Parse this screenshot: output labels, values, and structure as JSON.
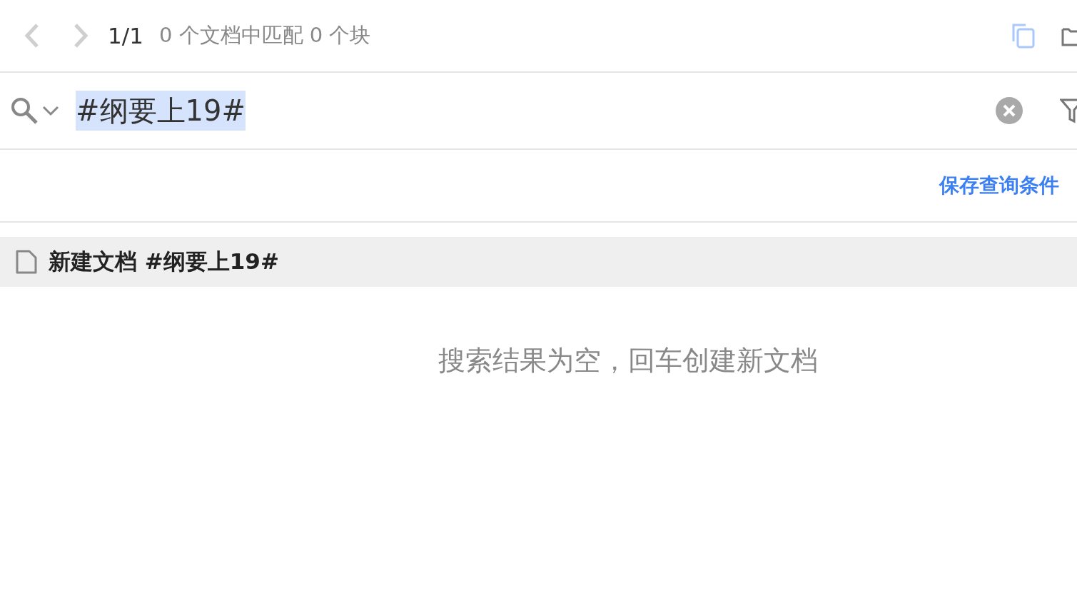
{
  "toolbar": {
    "back_enabled": false,
    "forward_enabled": false,
    "page": "1/1",
    "summary": "0 个文档中匹配 0 个块"
  },
  "search": {
    "value": "#纲要上19#",
    "value_selected": true
  },
  "actions": {
    "save_query": "保存查询条件"
  },
  "results": [
    {
      "kind": "new-doc",
      "label": "新建文档 #纲要上19#",
      "selected": true
    }
  ],
  "empty_message": "搜索结果为空，回车创建新文档"
}
